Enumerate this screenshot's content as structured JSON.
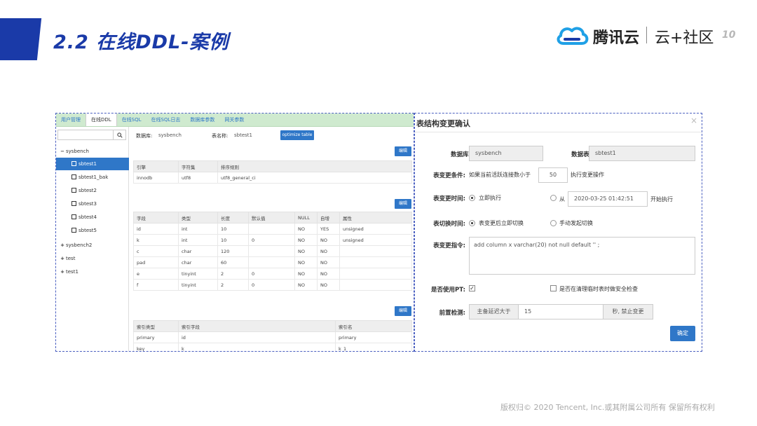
{
  "slide": {
    "title": "2.2  在线DDL-案例",
    "logo_text": "腾讯云",
    "logo_sub": "云+社区",
    "page_number": "10",
    "footer": "版权归© 2020 Tencent, Inc.或其附属公司所有  保留所有权利",
    "brand_color": "#1a3aa8"
  },
  "left_panel": {
    "tabs": [
      "用户管理",
      "在线DDL",
      "在线SQL",
      "在线SQL日志",
      "数据库参数",
      "网关参数"
    ],
    "active_tab": "在线DDL",
    "tree": {
      "nodes": [
        {
          "sign": "−",
          "label": "sysbench"
        },
        {
          "sign": "+",
          "label": "sysbench2"
        },
        {
          "sign": "+",
          "label": "test"
        },
        {
          "sign": "+",
          "label": "test1"
        }
      ],
      "children": [
        "sbtest1",
        "sbtest1_bak",
        "sbtest2",
        "sbtest3",
        "sbtest4",
        "sbtest5"
      ],
      "selected": "sbtest1"
    },
    "db_label": "数据库:",
    "db_value": "sysbench",
    "table_label": "表名称:",
    "table_value": "sbtest1",
    "optimize_button": "optimize table",
    "edit_label": "编辑",
    "engine_table": {
      "headers": [
        "引擎",
        "字符集",
        "排序规则"
      ],
      "rows": [
        [
          "innodb",
          "utf8",
          "utf8_general_ci"
        ]
      ]
    },
    "columns_table": {
      "headers": [
        "字段",
        "类型",
        "长度",
        "默认值",
        "NULL",
        "自增",
        "属性"
      ],
      "rows": [
        [
          "id",
          "int",
          "10",
          "",
          "NO",
          "YES",
          "unsigned"
        ],
        [
          "k",
          "int",
          "10",
          "0",
          "NO",
          "NO",
          "unsigned"
        ],
        [
          "c",
          "char",
          "120",
          "",
          "NO",
          "NO",
          ""
        ],
        [
          "pad",
          "char",
          "60",
          "",
          "NO",
          "NO",
          ""
        ],
        [
          "e",
          "tinyint",
          "2",
          "0",
          "NO",
          "NO",
          ""
        ],
        [
          "f",
          "tinyint",
          "2",
          "0",
          "NO",
          "NO",
          ""
        ]
      ]
    },
    "index_table": {
      "headers": [
        "索引类型",
        "索引字段",
        "索引名"
      ],
      "rows": [
        [
          "primary",
          "id",
          "primary"
        ],
        [
          "key",
          "k",
          "k_1"
        ]
      ]
    }
  },
  "dialog": {
    "title": "表结构变更确认",
    "close": "×",
    "db_label": "数据库:",
    "db_value": "sysbench",
    "table_label": "数据表:",
    "table_value": "sbtest1",
    "cond_label": "表变更条件:",
    "cond_prefix": "如果当前活跃连接数小于",
    "cond_value": "50",
    "cond_suffix": "执行变更操作",
    "time_label": "表变更时间:",
    "time_now": "立即执行",
    "time_from": "从",
    "time_value": "2020-03-25 01:42:51",
    "time_suffix": "开始执行",
    "switch_label": "表切换时间:",
    "switch_auto": "表变更后立即切换",
    "switch_manual": "手动发起切换",
    "cmd_label": "表变更指令:",
    "cmd_value": "add column x varchar(20)  not null default '' ;",
    "pt_label": "是否使用PT:",
    "pt_checked": true,
    "cleanup_label": "是否在清理临时表时做安全检查",
    "precheck_label": "前置检测:",
    "precheck_prefix": "主备延迟大于",
    "precheck_value": "15",
    "precheck_suffix": "秒, 禁止变更",
    "ok_button": "确定"
  }
}
